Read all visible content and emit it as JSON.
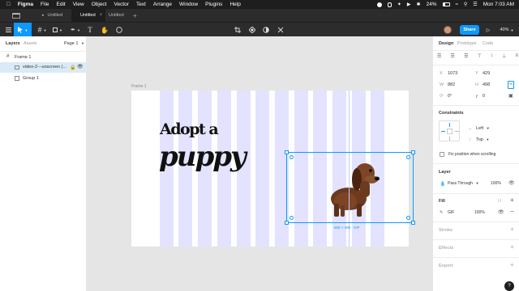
{
  "menubar": {
    "app": "Figma",
    "items": [
      "File",
      "Edit",
      "View",
      "Object",
      "Vector",
      "Text",
      "Arrange",
      "Window",
      "Plugins",
      "Help"
    ],
    "battery": "24%",
    "clock": "Mon 7:03 AM"
  },
  "tabs": [
    {
      "label": "Untitled"
    },
    {
      "label": "Untitled"
    },
    {
      "label": "Untitled"
    }
  ],
  "toolbar": {
    "share_label": "Share",
    "zoom": "40%"
  },
  "left": {
    "tab_layers": "Layers",
    "tab_assets": "Assets",
    "page": "Page 1",
    "layers": [
      {
        "label": "Frame 1"
      },
      {
        "label": "video-2---unscreen (..."
      },
      {
        "label": "Group 1"
      }
    ]
  },
  "canvas": {
    "frame_label": "Frame 1",
    "headline1": "Adopt a",
    "headline2": "puppy",
    "size_badge": "882 × 498 · GIF"
  },
  "right": {
    "tabs": [
      "Design",
      "Prototype",
      "Code"
    ],
    "x_label": "X",
    "x": "1073",
    "y_label": "Y",
    "y": "429",
    "w_label": "W",
    "w": "882",
    "h_label": "H",
    "h": "498",
    "rotation": "0°",
    "radius": "0",
    "constraints_title": "Constraints",
    "h_constraint": "Left",
    "v_constraint": "Top",
    "fix_position": "Fix position when scrolling",
    "layer_title": "Layer",
    "blend": "Pass Through",
    "layer_opacity": "100%",
    "fill_title": "Fill",
    "fill_type": "GIF",
    "fill_opacity": "100%",
    "stroke_title": "Stroke",
    "effects_title": "Effects",
    "export_title": "Export"
  },
  "colors": {
    "accent": "#0d99ff",
    "stripe": "#e3e3ff"
  }
}
